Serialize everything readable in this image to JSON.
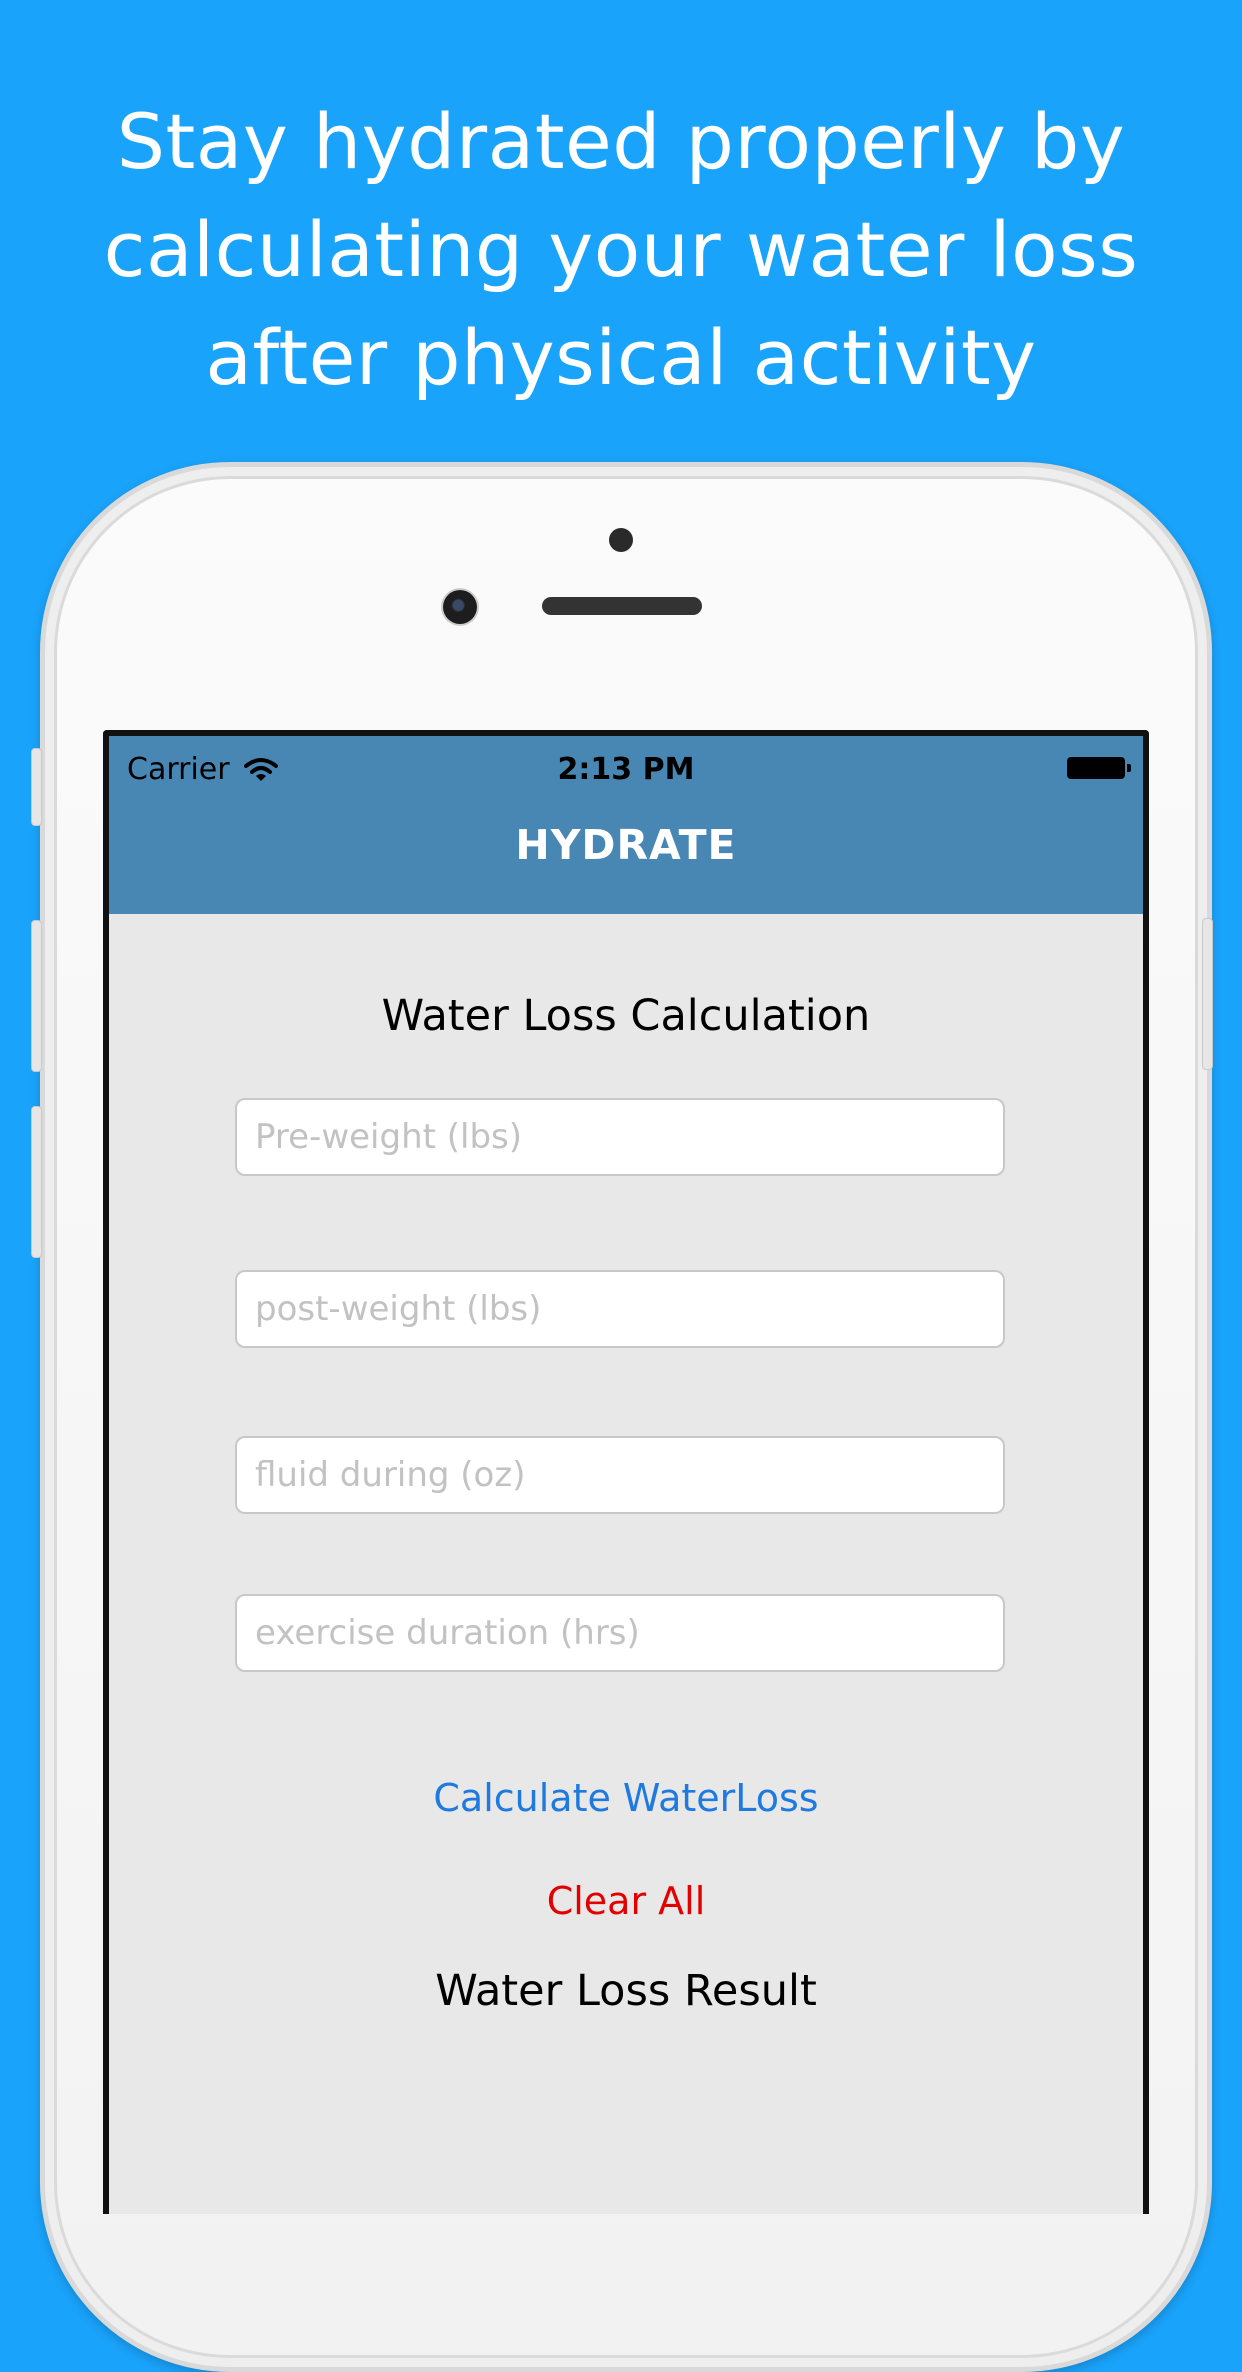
{
  "promo": {
    "headline_lines": [
      "Stay hydrated properly by",
      "calculating your water loss",
      "after physical activity"
    ]
  },
  "status_bar": {
    "carrier": "Carrier",
    "wifi_icon": "wifi-icon",
    "time": "2:13 PM",
    "battery_icon": "battery-icon"
  },
  "nav": {
    "title": "HYDRATE"
  },
  "form": {
    "title": "Water Loss Calculation",
    "fields": [
      {
        "placeholder": "Pre-weight (lbs)",
        "value": ""
      },
      {
        "placeholder": "post-weight (lbs)",
        "value": ""
      },
      {
        "placeholder": "fluid during (oz)",
        "value": ""
      },
      {
        "placeholder": "exercise duration (hrs)",
        "value": ""
      }
    ],
    "calculate_label": "Calculate WaterLoss",
    "clear_label": "Clear All",
    "result_label": "Water Loss Result"
  },
  "colors": {
    "background": "#1aa3fb",
    "nav_bar": "#4887b3",
    "screen_bg": "#e8e8e8",
    "calculate_text": "#1f7ae0",
    "clear_text": "#e30000"
  }
}
